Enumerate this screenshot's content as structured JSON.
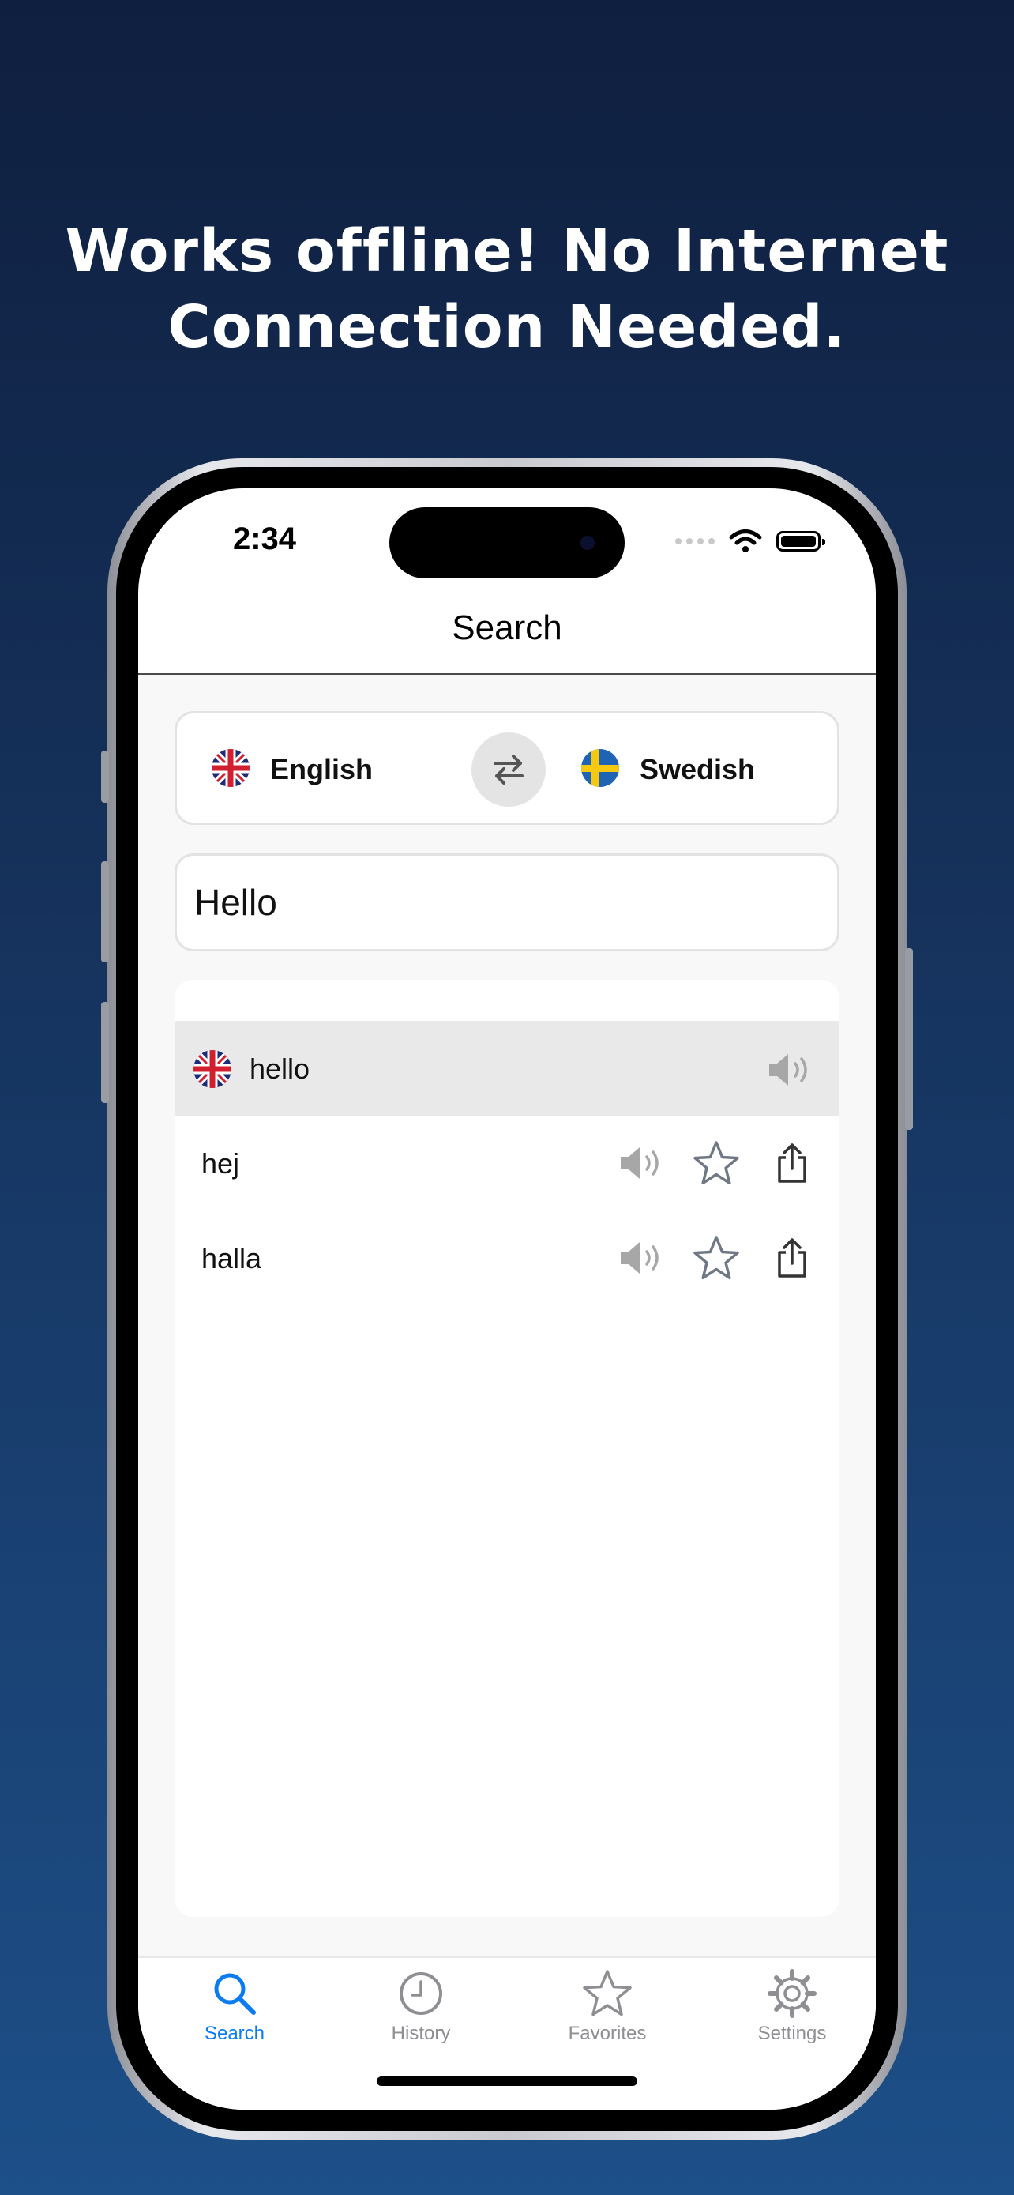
{
  "headline": {
    "line1": "Works offline! No Internet",
    "line2": "Connection Needed."
  },
  "status_bar": {
    "time": "2:34"
  },
  "nav": {
    "title": "Search"
  },
  "language_selector": {
    "source": {
      "label": "English",
      "flag": "uk-flag-icon"
    },
    "target": {
      "label": "Swedish",
      "flag": "sweden-flag-icon"
    },
    "swap_icon": "swap-arrows-icon"
  },
  "search": {
    "value": "Hello",
    "placeholder": ""
  },
  "results": {
    "source_row": {
      "word": "hello",
      "flag": "uk-flag-icon"
    },
    "translations": [
      {
        "word": "hej"
      },
      {
        "word": "halla"
      }
    ]
  },
  "tabbar": {
    "tabs": [
      {
        "label": "Search",
        "icon": "search-icon",
        "active": true
      },
      {
        "label": "History",
        "icon": "clock-icon",
        "active": false
      },
      {
        "label": "Favorites",
        "icon": "star-icon",
        "active": false
      },
      {
        "label": "Settings",
        "icon": "gear-icon",
        "active": false
      }
    ]
  },
  "colors": {
    "accent": "#0b7cf0",
    "inactive": "#8e8e93",
    "icon_gray": "#6f7884"
  }
}
